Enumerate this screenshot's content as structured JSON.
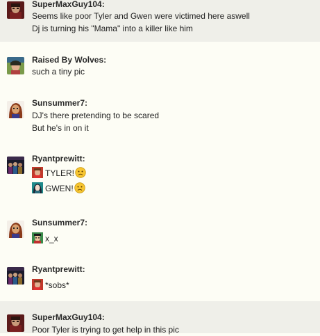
{
  "comments": [
    {
      "author": "SuperMaxGuy104:",
      "avatar_icon": "avatar-supermaxguy104",
      "lines": [
        "Seems like poor Tyler and Gwen were victimed here aswell",
        "Dj is turning his \"Mama\" into a killer like him"
      ]
    },
    {
      "author": "Raised By Wolves:",
      "avatar_icon": "avatar-raised-by-wolves",
      "lines": [
        "such a tiny pic"
      ]
    },
    {
      "author": "Sunsummer7:",
      "avatar_icon": "avatar-sunsummer7",
      "lines": [
        "DJ's there pretending to be scared",
        "But he's in on it"
      ]
    },
    {
      "author": "Ryantprewitt:",
      "avatar_icon": "avatar-ryantprewitt",
      "lines": [
        "TYLER!",
        "GWEN!"
      ],
      "line_icons": [
        "tyler-character-icon",
        "gwen-character-icon"
      ],
      "line_emoticons": [
        "sad-face-emoticon",
        "sad-face-emoticon"
      ]
    },
    {
      "author": "Sunsummer7:",
      "avatar_icon": "avatar-sunsummer7",
      "lines": [
        "x_x"
      ],
      "line_icons": [
        "character-icon"
      ]
    },
    {
      "author": "Ryantprewitt:",
      "avatar_icon": "avatar-ryantprewitt",
      "lines": [
        "*sobs*"
      ],
      "line_icons": [
        "tyler-character-icon"
      ]
    },
    {
      "author": "SuperMaxGuy104:",
      "avatar_icon": "avatar-supermaxguy104",
      "lines": [
        "Poor Tyler is trying to get help in this pic"
      ]
    }
  ],
  "colors": {
    "background": "#fdfdf5",
    "alt_background": "#efefe9",
    "emoticon_fill": "#f7c531"
  }
}
